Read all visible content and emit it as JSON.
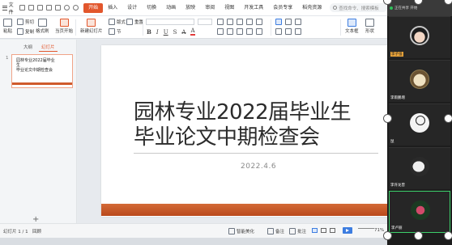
{
  "menubar": {
    "file_label": "文件",
    "tabs": [
      {
        "label": "开始",
        "active": true
      },
      {
        "label": "插入"
      },
      {
        "label": "设计"
      },
      {
        "label": "切换"
      },
      {
        "label": "动画"
      },
      {
        "label": "放映"
      },
      {
        "label": "审阅"
      },
      {
        "label": "视图"
      },
      {
        "label": "开发工具"
      },
      {
        "label": "会员专享"
      },
      {
        "label": "稻壳资源"
      }
    ],
    "search_placeholder": "查找命令、搜索模板"
  },
  "ribbon": {
    "paste": "粘贴",
    "cut": "剪切",
    "copy": "复制",
    "format_painter": "格式刷",
    "play_from_current": "当页开始",
    "new_slide": "新建幻灯片",
    "layout": "版式",
    "section": "节",
    "reset": "重置",
    "textbox": "文本框",
    "shape": "形状"
  },
  "left_panel": {
    "tabs": [
      "大纲",
      "幻灯片"
    ],
    "active_tab": "幻灯片",
    "thumb_number": "1",
    "thumb_title": "园林专业2022届毕业生\n毕业论文中期检查会",
    "add_symbol": "+"
  },
  "slide": {
    "title": "园林专业2022届毕业生\n毕业论文中期检查会",
    "date": "2022.4.6",
    "band_color": "#c4552a"
  },
  "statusbar": {
    "slide_counter": "幻灯片 1 / 1",
    "theme": "回顾",
    "beautify": "智能美化",
    "notes": "备注",
    "comments": "批注",
    "zoom": "71%"
  },
  "video_panel": {
    "header": "正在共享 开始",
    "participants": [
      {
        "name": "李子强",
        "highlight": true
      },
      {
        "name": "李雨鹏增",
        "highlight": false
      },
      {
        "name": "鼠",
        "highlight": false
      },
      {
        "name": "李许龙曾",
        "highlight": false
      },
      {
        "name": "李卢丽",
        "highlight": false,
        "speaking": true
      }
    ]
  },
  "colors": {
    "accent": "#e2562c",
    "speaking_border": "#3ccf6a"
  }
}
